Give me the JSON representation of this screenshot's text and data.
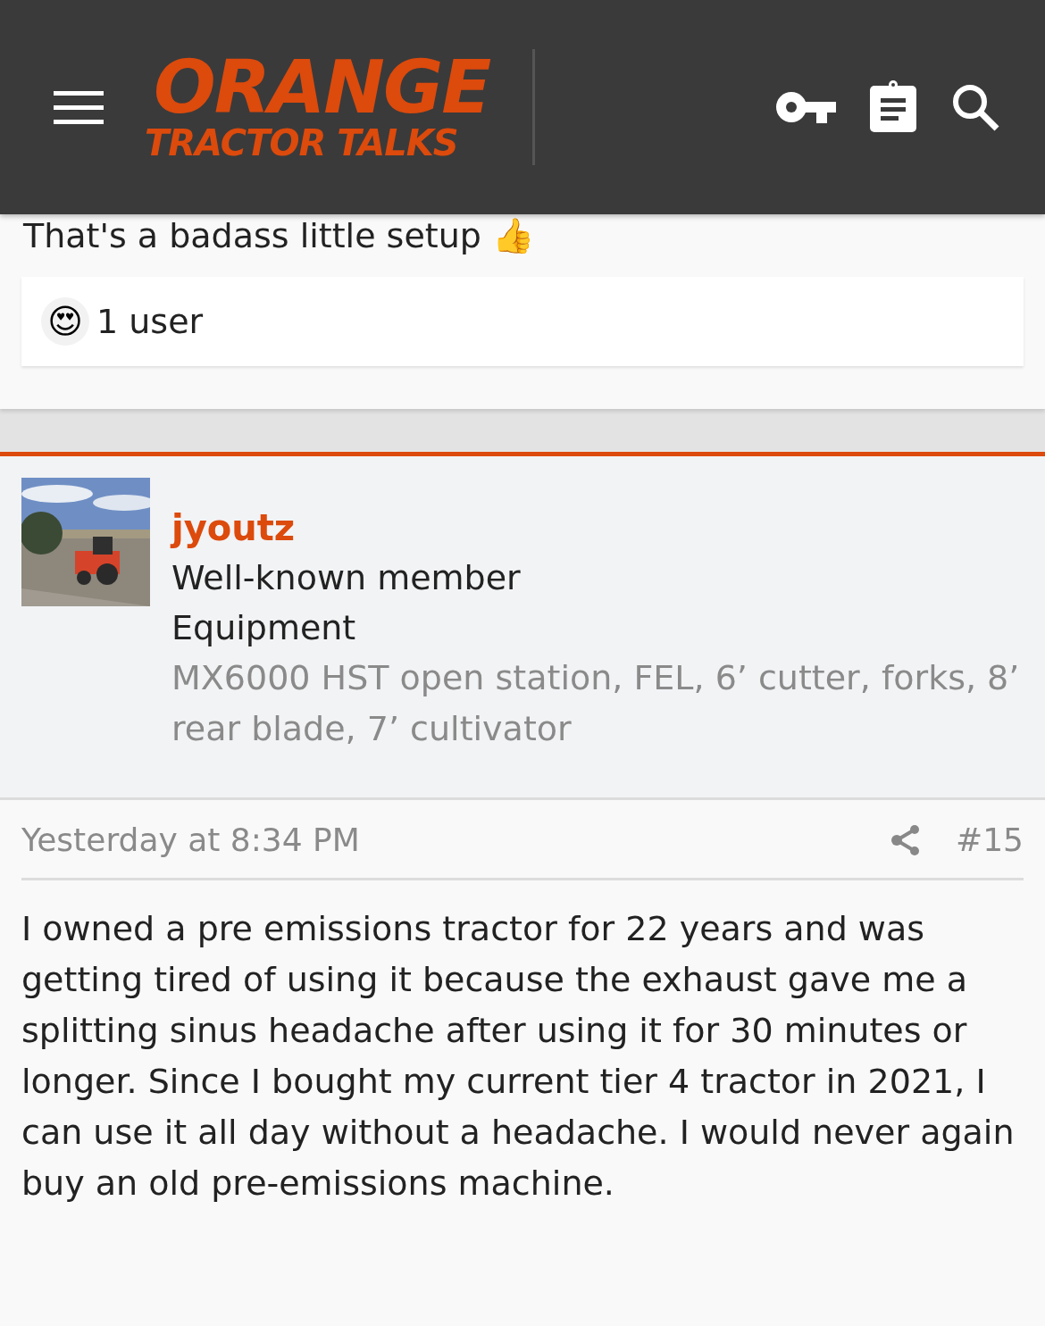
{
  "header": {
    "logo_top": "ORANGE",
    "logo_bottom": "TRACTOR TALKS"
  },
  "previous_post": {
    "text_cut": "That's a badass little setup 👍",
    "reactions": {
      "emoji": "😍",
      "label": "1 user"
    }
  },
  "post": {
    "author": {
      "name": "jyoutz",
      "title": "Well-known member",
      "field_label": "Equipment",
      "field_value": "MX6000 HST open station, FEL, 6’ cutter, forks, 8’ rear blade, 7’ cultivator"
    },
    "time": "Yesterday at 8:34 PM",
    "number": "#15",
    "body": "I owned a pre emissions tractor for 22 years and was getting tired of using it because the exhaust gave me a splitting sinus headache after using it for 30 minutes or longer. Since I bought my current tier 4 tractor in 2021, I can use it all day without a headache. I would never again buy an old pre-emissions machine."
  }
}
